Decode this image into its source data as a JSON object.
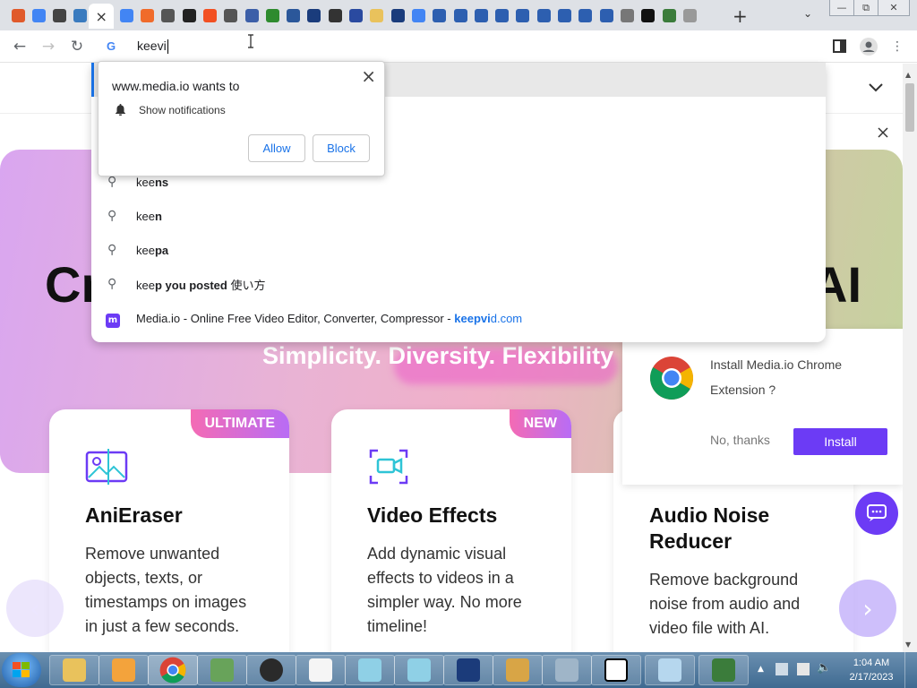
{
  "browser": {
    "tab_icons": [
      "browser-icon",
      "google-icon",
      "gimp-icon",
      "meter-icon",
      "close-tab-icon",
      "google-icon",
      "gear-icon",
      "sync-icon",
      "github-icon",
      "microsoft-icon",
      "globe-icon",
      "chromium-icon",
      "xbox-icon",
      "word-icon",
      "app-icon",
      "tool-icon",
      "arrow-icon",
      "folder-icon",
      "s-icon",
      "google-icon",
      "a-icon",
      "a-icon",
      "a-icon",
      "a-icon",
      "a-icon",
      "a-icon",
      "a-icon",
      "a-icon",
      "a-icon",
      "apple-icon",
      "amd-icon",
      "puzzle-icon",
      "globe-icon"
    ],
    "new_tab_label": "+",
    "address_text": "keevi",
    "window_min": "—",
    "window_restore": "⧉",
    "window_close": "✕"
  },
  "permission_popup": {
    "title": "www.media.io wants to",
    "permission": "Show notifications",
    "allow": "Allow",
    "block": "Block",
    "close": "×"
  },
  "omnibox": {
    "suggestions": [
      {
        "prefix": "kee",
        "rest": "ns"
      },
      {
        "prefix": "kee",
        "rest": "n"
      },
      {
        "prefix": "kee",
        "rest": "pa"
      },
      {
        "prefix": "kee",
        "rest": "p you posted",
        "suffix": " 使い方"
      }
    ],
    "site": {
      "title": "Media.io - Online Free Video Editor, Converter, Compressor - ",
      "url_bold": "keepvi",
      "url_rest": "d.com"
    }
  },
  "page": {
    "hero_left": "Cr",
    "hero_right": "AI",
    "tagline": "Simplicity. Diversity. Flexibility",
    "cards": [
      {
        "badge": "ULTIMATE",
        "title": "AniEraser",
        "desc_lines": [
          "Remove unwanted",
          "objects, texts, or",
          "timestamps on images",
          "in just a few seconds."
        ]
      },
      {
        "badge": "NEW",
        "title": "Video Effects",
        "desc_lines": [
          "Add dynamic visual",
          "effects to videos in a",
          "simpler way. No more",
          "timeline!"
        ]
      },
      {
        "badge": "",
        "title_lines": [
          "Audio Noise",
          "Reducer"
        ],
        "desc_lines": [
          "Remove background",
          "noise from audio and",
          "video file with AI."
        ]
      }
    ],
    "extension_prompt": {
      "line1": "Install Media.io Chrome",
      "line2": "Extension ?",
      "no": "No, thanks",
      "install": "Install"
    }
  },
  "taskbar": {
    "time": "1:04 AM",
    "date": "2/17/2023"
  }
}
